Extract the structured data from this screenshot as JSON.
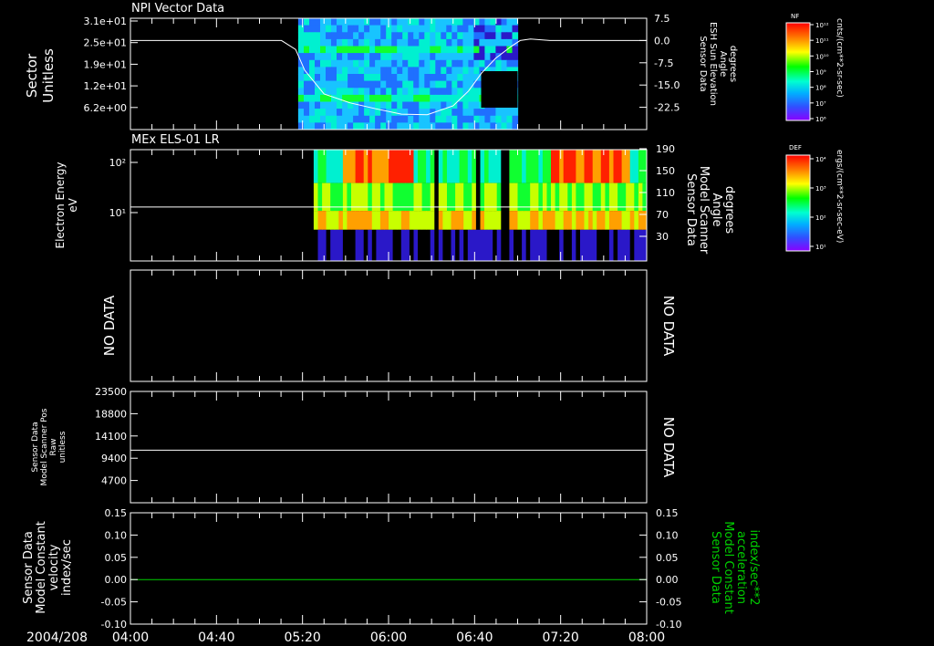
{
  "chart_data": [
    {
      "type": "heatmap",
      "title": "NPI Vector Data",
      "ylabel": [
        "Sector",
        "Unitless"
      ],
      "y_ticks": [
        "3.1e+01",
        "2.5e+01",
        "1.9e+01",
        "1.2e+01",
        "6.2e+00"
      ],
      "right_ylabel": [
        "Sensor Data",
        "ESH Sun Elevation",
        "Angle",
        "degrees"
      ],
      "right_ticks": [
        "7.5",
        "0.0",
        "-7.5",
        "-15.0",
        "-22.5"
      ],
      "right_ylim": [
        -30,
        7.5
      ],
      "data_window_hours": [
        5.3,
        7.0
      ],
      "line_series": {
        "hours": [
          4.0,
          5.17,
          5.28,
          5.35,
          5.5,
          5.7,
          5.9,
          6.1,
          6.3,
          6.5,
          6.62,
          6.72,
          6.83,
          6.95,
          7.02,
          7.1,
          7.25,
          7.6,
          8.0
        ],
        "values": [
          0,
          0,
          -3,
          -10,
          -18,
          -21,
          -23,
          -24.8,
          -25,
          -22,
          -17,
          -11,
          -6,
          -2,
          0,
          0.5,
          0,
          0,
          0
        ]
      },
      "colorbar": {
        "label": "NF",
        "units": "cnts/(cm**2-sr-sec)",
        "ticks": [
          "10¹²",
          "10¹¹",
          "10¹⁰",
          "10⁹",
          "10⁸",
          "10⁷",
          "10⁶"
        ]
      }
    },
    {
      "type": "heatmap",
      "title": "MEx ELS-01 LR",
      "ylabel": [
        "Electron Energy",
        "eV"
      ],
      "y_ticks": [
        "10²",
        "10¹"
      ],
      "right_ylabel": [
        "Sensor Data",
        "Model Scanner",
        "Angle",
        "degrees"
      ],
      "right_ticks": [
        "190",
        "150",
        "110",
        "70",
        "30"
      ],
      "data_window_hours": [
        5.42,
        8.0
      ],
      "line_value_fraction": 0.515,
      "colorbar": {
        "label": "DEF",
        "units": "ergs/(cm**2-sr-sec-eV)",
        "ticks": [
          "10⁴",
          "10³",
          "10²",
          "10¹"
        ]
      }
    },
    {
      "type": "line",
      "left_text": "NO DATA",
      "right_text": "NO DATA"
    },
    {
      "type": "line",
      "ylabel": [
        "Sensor Data",
        "Model Scanner Pos",
        "Raw",
        "unitless"
      ],
      "y_ticks": [
        "23500",
        "18800",
        "14100",
        "9400",
        "4700"
      ],
      "ylim": [
        0,
        23500
      ],
      "constant_value": 11100,
      "right_text": "NO DATA"
    },
    {
      "type": "line",
      "ylabel": [
        "Sensor Data",
        "Model Constant",
        "velocity",
        "index/sec"
      ],
      "y_ticks": [
        "0.15",
        "0.10",
        "0.05",
        "0.00",
        "-0.05",
        "-0.10"
      ],
      "right_ylabel": [
        "Sensor Data",
        "Model Constant",
        "acceleration",
        "index/sec**2"
      ],
      "right_ticks": [
        "0.15",
        "0.10",
        "0.05",
        "0.00",
        "-0.05",
        "-0.10"
      ],
      "ylim": [
        -0.1,
        0.15
      ],
      "constant_value": 0.0,
      "line_color": "#00d000"
    }
  ],
  "x_axis": {
    "date": "2004/208",
    "ticks": [
      "04:00",
      "04:40",
      "05:20",
      "06:00",
      "06:40",
      "07:20",
      "08:00"
    ],
    "range_hours": [
      4,
      8
    ]
  },
  "colors": {
    "background": "#000000",
    "axis": "#ffffff",
    "green_label": "#00d000"
  }
}
